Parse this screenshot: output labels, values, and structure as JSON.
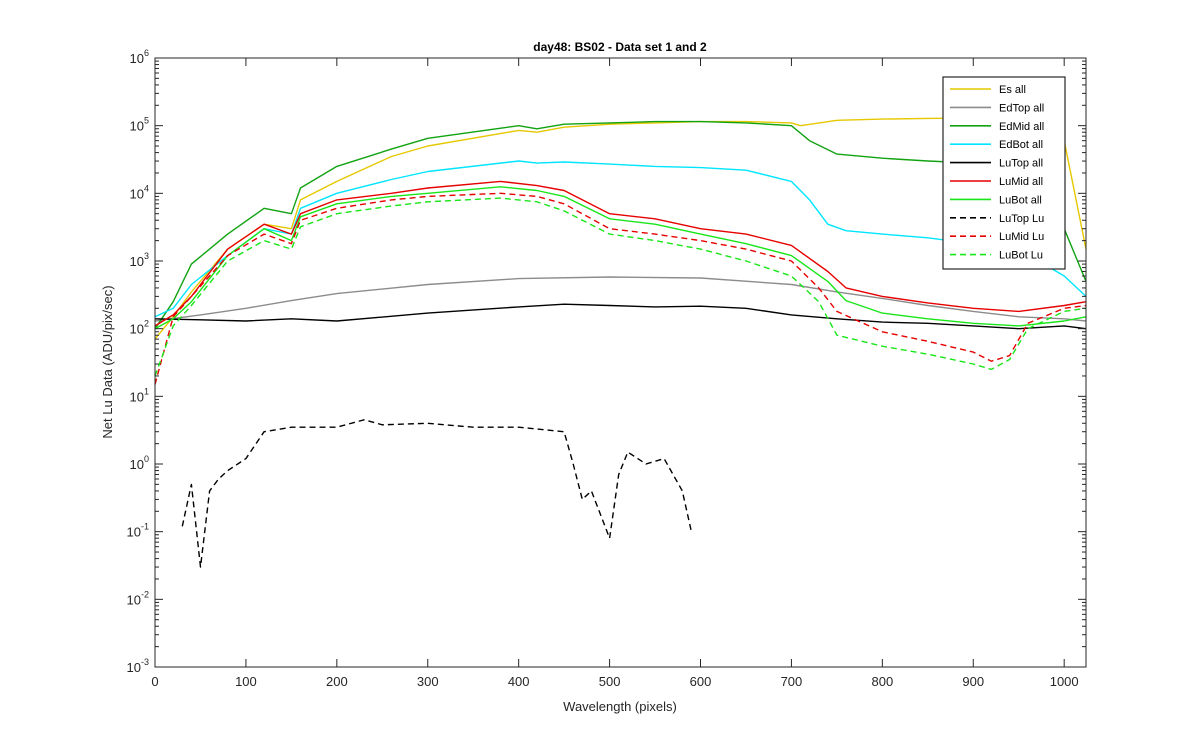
{
  "chart_data": {
    "type": "line",
    "title": "day48: BS02 - Data set 1 and 2",
    "xlabel": "Wavelength (pixels)",
    "ylabel": "Net Lu Data (ADU/pix/sec)",
    "xlim": [
      0,
      1024
    ],
    "ylim": [
      0.001,
      1000000
    ],
    "yscale": "log",
    "grid": false,
    "legend_position": "top-right",
    "x_ticks": [
      "0",
      "100",
      "200",
      "300",
      "400",
      "500",
      "600",
      "700",
      "800",
      "900",
      "1000"
    ],
    "y_ticks": [
      {
        "base": "10",
        "exp": "-3"
      },
      {
        "base": "10",
        "exp": "-2"
      },
      {
        "base": "10",
        "exp": "-1"
      },
      {
        "base": "10",
        "exp": "0"
      },
      {
        "base": "10",
        "exp": "1"
      },
      {
        "base": "10",
        "exp": "2"
      },
      {
        "base": "10",
        "exp": "3"
      },
      {
        "base": "10",
        "exp": "4"
      },
      {
        "base": "10",
        "exp": "5"
      },
      {
        "base": "10",
        "exp": "6"
      }
    ],
    "series": [
      {
        "name": "Es  all",
        "color": "#e6c800",
        "dash": "solid",
        "x": [
          0,
          20,
          40,
          80,
          120,
          150,
          160,
          200,
          260,
          300,
          400,
          420,
          450,
          500,
          550,
          600,
          650,
          700,
          710,
          750,
          800,
          850,
          900,
          950,
          1000,
          1024
        ],
        "y": [
          70,
          150,
          350,
          1500,
          3500,
          3000,
          8000,
          15000,
          35000,
          50000,
          85000,
          80000,
          95000,
          105000,
          110000,
          115000,
          115000,
          110000,
          100000,
          120000,
          125000,
          128000,
          130000,
          128000,
          60000,
          1500
        ]
      },
      {
        "name": "EdTop  all",
        "color": "#8c8c8c",
        "dash": "solid",
        "x": [
          0,
          50,
          100,
          150,
          200,
          300,
          400,
          500,
          600,
          700,
          750,
          800,
          850,
          900,
          950,
          1000,
          1024
        ],
        "y": [
          130,
          160,
          200,
          260,
          330,
          450,
          550,
          580,
          560,
          450,
          350,
          280,
          220,
          180,
          150,
          140,
          130
        ]
      },
      {
        "name": "EdMid  all",
        "color": "#12a312",
        "dash": "solid",
        "x": [
          0,
          20,
          40,
          80,
          120,
          150,
          160,
          200,
          260,
          300,
          400,
          420,
          450,
          500,
          550,
          600,
          650,
          700,
          720,
          750,
          800,
          850,
          900,
          950,
          1000,
          1024
        ],
        "y": [
          100,
          250,
          900,
          2500,
          6000,
          5000,
          12000,
          25000,
          45000,
          65000,
          100000,
          90000,
          105000,
          110000,
          115000,
          115000,
          110000,
          100000,
          60000,
          38000,
          33000,
          30000,
          28000,
          27000,
          3000,
          500
        ]
      },
      {
        "name": "EdBot  all",
        "color": "#00e5ff",
        "dash": "solid",
        "x": [
          0,
          20,
          40,
          80,
          120,
          150,
          160,
          200,
          260,
          300,
          400,
          420,
          450,
          500,
          550,
          600,
          650,
          700,
          720,
          740,
          760,
          800,
          850,
          900,
          950,
          1000,
          1024
        ],
        "y": [
          150,
          200,
          450,
          1200,
          3000,
          2500,
          6000,
          10000,
          16000,
          21000,
          30000,
          28000,
          29000,
          27000,
          25000,
          24000,
          22000,
          15000,
          8000,
          3500,
          2800,
          2500,
          2200,
          1800,
          1500,
          600,
          300
        ]
      },
      {
        "name": "LuTop  all",
        "color": "#000000",
        "dash": "solid",
        "x": [
          0,
          50,
          100,
          150,
          200,
          300,
          400,
          450,
          500,
          550,
          600,
          650,
          700,
          750,
          800,
          850,
          900,
          950,
          1000,
          1024
        ],
        "y": [
          140,
          135,
          130,
          140,
          130,
          170,
          210,
          230,
          220,
          210,
          215,
          200,
          160,
          140,
          125,
          120,
          110,
          100,
          110,
          100
        ]
      },
      {
        "name": "LuMid  all",
        "color": "#e60000",
        "dash": "solid",
        "x": [
          0,
          20,
          40,
          80,
          120,
          150,
          160,
          200,
          260,
          300,
          380,
          420,
          450,
          500,
          550,
          600,
          650,
          700,
          740,
          760,
          800,
          850,
          900,
          950,
          1000,
          1024
        ],
        "y": [
          110,
          160,
          300,
          1500,
          3500,
          2500,
          5000,
          8000,
          10000,
          12000,
          15000,
          13000,
          11000,
          5000,
          4200,
          3000,
          2500,
          1700,
          700,
          400,
          300,
          240,
          200,
          180,
          220,
          250
        ]
      },
      {
        "name": "LuBot  all",
        "color": "#19e619",
        "dash": "solid",
        "x": [
          0,
          20,
          40,
          80,
          120,
          150,
          160,
          200,
          260,
          300,
          380,
          420,
          450,
          500,
          550,
          600,
          650,
          700,
          740,
          760,
          800,
          850,
          900,
          950,
          1000,
          1024
        ],
        "y": [
          100,
          140,
          250,
          1200,
          3000,
          2000,
          4500,
          7000,
          9000,
          10000,
          12500,
          11000,
          9000,
          4200,
          3500,
          2500,
          1800,
          1200,
          500,
          260,
          170,
          140,
          120,
          110,
          130,
          150
        ]
      },
      {
        "name": "LuTop  Lu",
        "color": "#000000",
        "dash": "dash",
        "x": [
          30,
          40,
          50,
          60,
          70,
          80,
          100,
          120,
          150,
          200,
          230,
          250,
          300,
          350,
          400,
          450,
          460,
          470,
          480,
          500,
          510,
          520,
          540,
          560,
          580,
          590
        ],
        "y": [
          0.12,
          0.5,
          0.03,
          0.4,
          0.6,
          0.8,
          1.2,
          3,
          3.5,
          3.5,
          4.5,
          3.8,
          4,
          3.5,
          3.5,
          3,
          1,
          0.3,
          0.4,
          0.08,
          0.7,
          1.5,
          1,
          1.2,
          0.4,
          0.1
        ]
      },
      {
        "name": "LuMid  Lu",
        "color": "#e60000",
        "dash": "dash",
        "x": [
          0,
          20,
          40,
          80,
          120,
          150,
          160,
          200,
          260,
          300,
          380,
          420,
          450,
          500,
          550,
          600,
          650,
          700,
          730,
          750,
          800,
          850,
          900,
          920,
          940,
          960,
          1000,
          1024
        ],
        "y": [
          15,
          150,
          300,
          1200,
          2500,
          1800,
          4000,
          6000,
          8000,
          9000,
          10000,
          9000,
          7000,
          3000,
          2500,
          2000,
          1500,
          1000,
          400,
          180,
          90,
          65,
          45,
          33,
          40,
          120,
          200,
          220
        ]
      },
      {
        "name": "LuBot  Lu",
        "color": "#19e619",
        "dash": "dash",
        "x": [
          0,
          20,
          40,
          80,
          120,
          150,
          160,
          200,
          260,
          300,
          380,
          420,
          450,
          500,
          550,
          600,
          650,
          700,
          730,
          750,
          800,
          850,
          900,
          920,
          940,
          960,
          1000,
          1024
        ],
        "y": [
          20,
          110,
          220,
          1000,
          2000,
          1500,
          3200,
          5000,
          6500,
          7500,
          8500,
          7500,
          5500,
          2500,
          2000,
          1500,
          1000,
          600,
          250,
          80,
          55,
          42,
          30,
          25,
          35,
          100,
          180,
          200
        ]
      }
    ]
  }
}
